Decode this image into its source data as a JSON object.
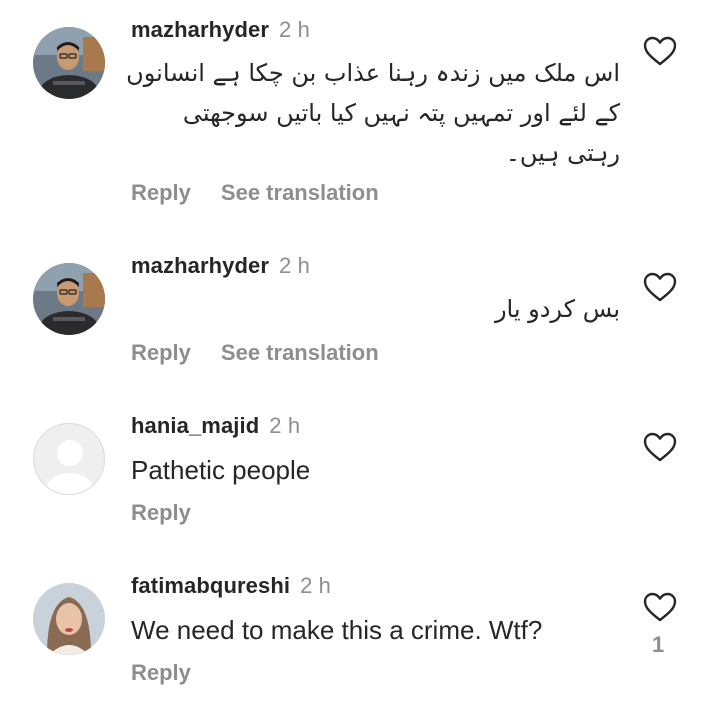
{
  "comments": [
    {
      "username": "mazharhyder",
      "time": "2 h",
      "text_lines": [
        "اس ملک میں زندہ رہنا عذاب بن چکا ہے انسانوں",
        "کے لئے اور تمہیں پتہ نہیں کیا باتیں سوجھتی",
        "رہتی ہیں۔"
      ],
      "reply_label": "Reply",
      "translate_label": "See translation",
      "avatar": "profile-photo"
    },
    {
      "username": "mazharhyder",
      "time": "2 h",
      "text_lines": [
        "بس کردو یار"
      ],
      "reply_label": "Reply",
      "translate_label": "See translation",
      "avatar": "profile-photo"
    },
    {
      "username": "hania_majid",
      "time": "2 h",
      "text": "Pathetic people",
      "reply_label": "Reply",
      "avatar": "default-avatar"
    },
    {
      "username": "fatimabqureshi",
      "time": "2 h",
      "text": "We need to make this a crime. Wtf?",
      "reply_label": "Reply",
      "like_count": "1",
      "avatar": "profile-photo"
    }
  ],
  "icons": {
    "like": "heart-outline-icon"
  },
  "colors": {
    "text": "#262626",
    "secondary": "#8e8e8e",
    "background": "#ffffff"
  }
}
